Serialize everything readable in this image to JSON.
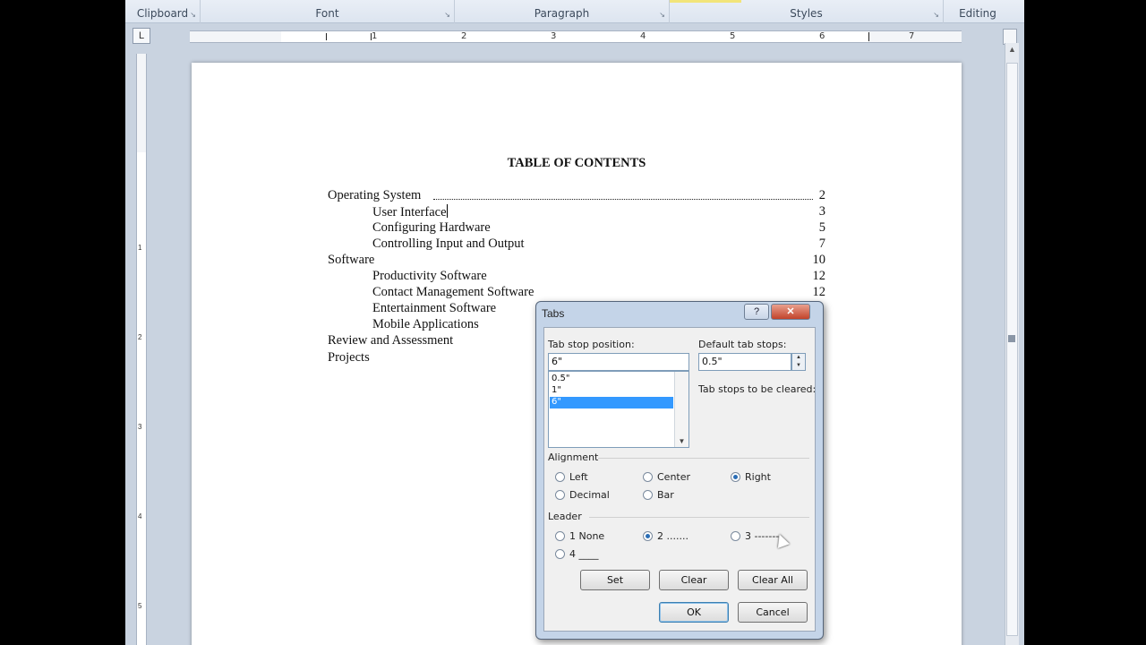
{
  "ribbon": {
    "groups": [
      {
        "label": "Clipboard"
      },
      {
        "label": "Font"
      },
      {
        "label": "Paragraph"
      },
      {
        "label": "Styles"
      },
      {
        "label": "Editing"
      }
    ],
    "launcher": "↘"
  },
  "ruler": {
    "corner_glyph": "L",
    "numbers": [
      "1",
      "2",
      "3",
      "4",
      "5",
      "6",
      "7"
    ],
    "vertical_numbers": [
      "1",
      "2",
      "3",
      "4",
      "5"
    ]
  },
  "document": {
    "title": "TABLE OF CONTENTS",
    "entries": [
      {
        "text": "Operating System",
        "page": "2",
        "indent": 0
      },
      {
        "text": "User Interface",
        "page": "3",
        "indent": 1
      },
      {
        "text": "Configuring Hardware",
        "page": "5",
        "indent": 1
      },
      {
        "text": "Controlling Input and Output",
        "page": "7",
        "indent": 1
      },
      {
        "text": "Software",
        "page": "10",
        "indent": 0
      },
      {
        "text": "Productivity Software",
        "page": "12",
        "indent": 1
      },
      {
        "text": "Contact Management Software",
        "page": "12",
        "indent": 1
      },
      {
        "text": "Entertainment Software",
        "page": "",
        "indent": 1
      },
      {
        "text": "Mobile Applications",
        "page": "",
        "indent": 1
      },
      {
        "text": "Review and Assessment",
        "page": "",
        "indent": 0
      },
      {
        "text": "Projects",
        "page": "",
        "indent": 0
      }
    ]
  },
  "dialog": {
    "title": "Tabs",
    "help_label": "?",
    "close_label": "✕",
    "tab_stop_position_label": "Tab stop position:",
    "tab_stop_position_value": "6\"",
    "tab_stop_list": [
      "0.5\"",
      "1\"",
      "6\""
    ],
    "selected_index": 2,
    "default_tab_stops_label": "Default tab stops:",
    "default_tab_stops_value": "0.5\"",
    "spinner_up": "▲",
    "spinner_down": "▼",
    "list_scroll_down": "▼",
    "tab_stops_cleared_label": "Tab stops to be cleared:",
    "alignment_label": "Alignment",
    "alignment_options": [
      {
        "label": "Left",
        "selected": false
      },
      {
        "label": "Center",
        "selected": false
      },
      {
        "label": "Right",
        "selected": true
      },
      {
        "label": "Decimal",
        "selected": false
      },
      {
        "label": "Bar",
        "selected": false
      }
    ],
    "leader_label": "Leader",
    "leader_options": [
      {
        "label": "1 None",
        "selected": false
      },
      {
        "label": "2 .......",
        "selected": true
      },
      {
        "label": "3 -------",
        "selected": false
      },
      {
        "label": "4 ____",
        "selected": false
      }
    ],
    "set_label": "Set",
    "clear_label": "Clear",
    "clear_all_label": "Clear All",
    "ok_label": "OK",
    "cancel_label": "Cancel"
  },
  "colors": {
    "selection": "#3399ff",
    "dialog_frame": "#c4d4e8",
    "close_button": "#c2432a"
  }
}
